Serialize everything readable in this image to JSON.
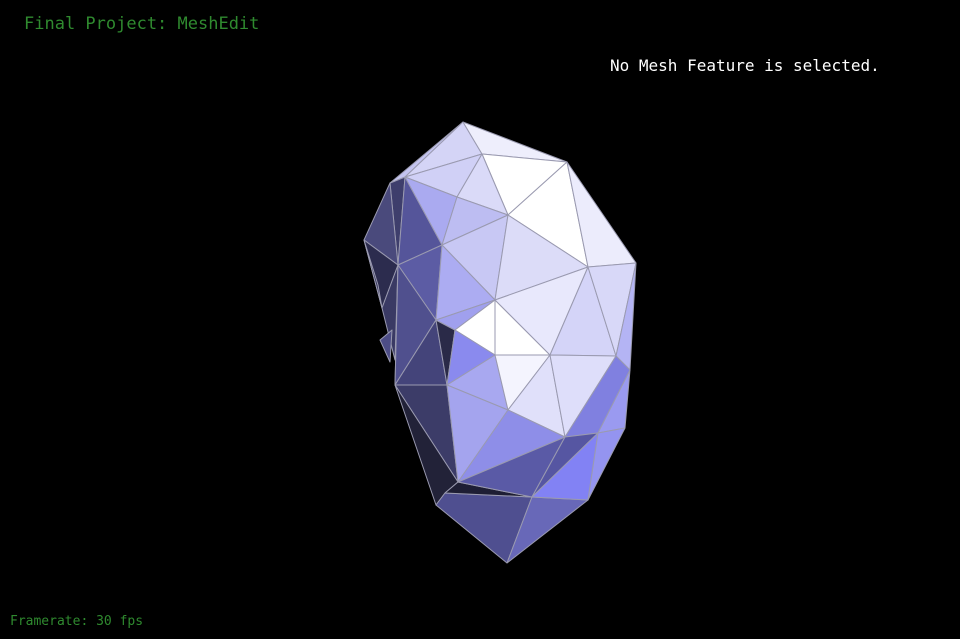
{
  "app": {
    "title": "Final Project: MeshEdit"
  },
  "status": {
    "message": "No Mesh Feature is selected."
  },
  "footer": {
    "framerate_label": "Framerate: 30 fps"
  },
  "colors": {
    "background": "#000000",
    "overlay_text": "#2f8a2f",
    "status_text": "#ffffff",
    "mesh_edge": "#9a9ab0"
  }
}
